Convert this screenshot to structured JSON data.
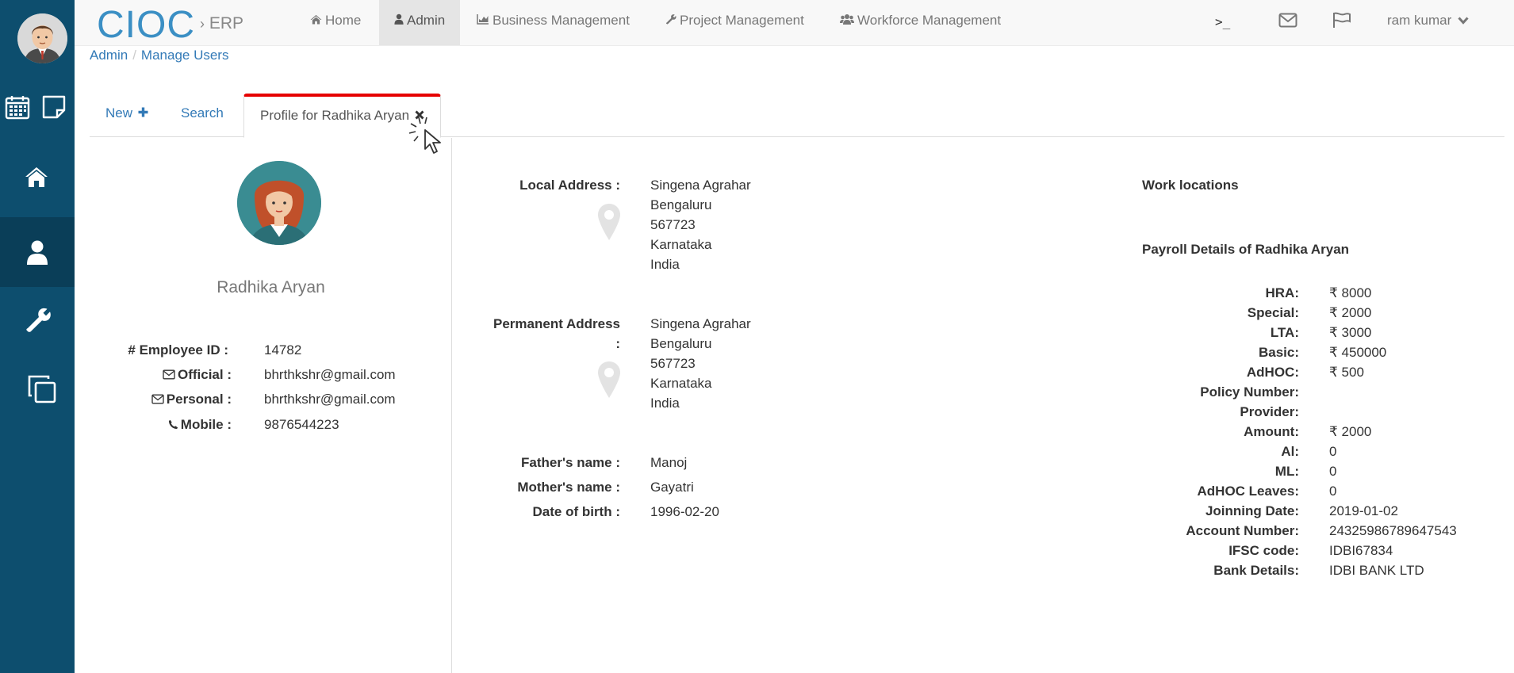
{
  "sidebar": {
    "avatar": "male-user-avatar",
    "items": [
      {
        "icon": "calendar-icon"
      },
      {
        "icon": "sticky-note-icon"
      },
      {
        "icon": "home-icon"
      },
      {
        "icon": "user-icon",
        "active": true
      },
      {
        "icon": "wrench-icon"
      },
      {
        "icon": "copy-icon"
      }
    ],
    "bg_color": "#0d4e6e"
  },
  "navbar": {
    "brand": "CIOC",
    "brand_sub": "ERP",
    "items": [
      {
        "label": "Home",
        "icon": "home-icon"
      },
      {
        "label": "Admin",
        "icon": "user-icon",
        "active": true
      },
      {
        "label": "Business Management",
        "icon": "chart-icon"
      },
      {
        "label": "Project Management",
        "icon": "wrench-icon"
      },
      {
        "label": "Workforce Management",
        "icon": "users-icon"
      }
    ],
    "terminal_icon": ">_",
    "user_name": "ram kumar"
  },
  "breadcrumb": {
    "items": [
      "Admin",
      "Manage Users"
    ]
  },
  "tabs": [
    {
      "label": "New"
    },
    {
      "label": "Search"
    },
    {
      "label": "Profile for Radhika Aryan",
      "active": true
    }
  ],
  "profile": {
    "name": "Radhika Aryan",
    "fields": [
      {
        "label": "# Employee ID :",
        "value": "14782"
      },
      {
        "label": "Official :",
        "value": "bhrthkshr@gmail.com"
      },
      {
        "label": "Personal :",
        "value": "bhrthkshr@gmail.com"
      },
      {
        "label": "Mobile :",
        "value": "9876544223"
      }
    ]
  },
  "addresses": {
    "local_label": "Local Address :",
    "local": [
      "Singena Agrahar",
      "Bengaluru",
      "567723",
      "Karnataka",
      "India"
    ],
    "permanent_label_1": "Permanent Address",
    "permanent_label_2": ":",
    "permanent": [
      "Singena Agrahar",
      "Bengaluru",
      "567723",
      "Karnataka",
      "India"
    ]
  },
  "family": [
    {
      "label": "Father's name :",
      "value": "Manoj"
    },
    {
      "label": "Mother's name :",
      "value": "Gayatri"
    },
    {
      "label": "Date of birth :",
      "value": "1996-02-20"
    }
  ],
  "work": {
    "locations_heading": "Work locations",
    "payroll_heading": "Payroll Details of Radhika Aryan",
    "payroll": [
      {
        "label": "HRA:",
        "value": "₹ 8000"
      },
      {
        "label": "Special:",
        "value": "₹ 2000"
      },
      {
        "label": "LTA:",
        "value": "₹ 3000"
      },
      {
        "label": "Basic:",
        "value": "₹ 450000"
      },
      {
        "label": "AdHOC:",
        "value": "₹ 500"
      },
      {
        "label": "Policy Number:",
        "value": ""
      },
      {
        "label": "Provider:",
        "value": ""
      },
      {
        "label": "Amount:",
        "value": "₹ 2000"
      },
      {
        "label": "Al:",
        "value": "0"
      },
      {
        "label": "ML:",
        "value": "0"
      },
      {
        "label": "AdHOC Leaves:",
        "value": "0"
      },
      {
        "label": "Joinning Date:",
        "value": "2019-01-02"
      },
      {
        "label": "Account Number:",
        "value": "24325986789647543"
      },
      {
        "label": "IFSC code:",
        "value": "IDBI67834"
      },
      {
        "label": "Bank Details:",
        "value": "IDBI BANK LTD"
      }
    ]
  },
  "colors": {
    "accent": "#337ab7",
    "brand": "#3b8fc4",
    "tab_active_border": "#e60000"
  }
}
